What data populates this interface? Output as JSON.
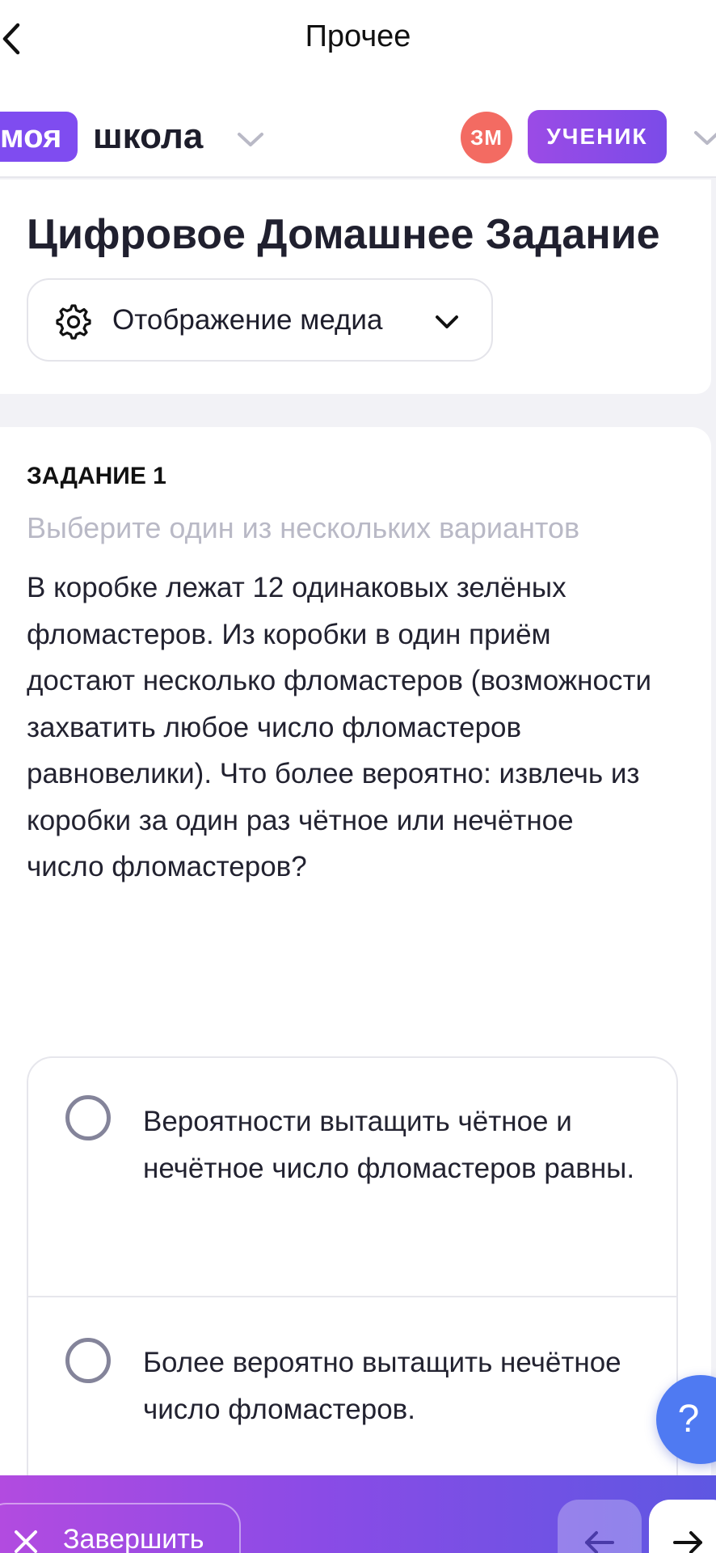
{
  "nav": {
    "title": "Прочее"
  },
  "brand": {
    "part1": "моя",
    "part2": "школа"
  },
  "user": {
    "initials": "ЗМ",
    "role": "УЧЕНИК"
  },
  "header": {
    "title": "Цифровое Домашнее Задание",
    "media_button_label": "Отображение медиа"
  },
  "task": {
    "number_label": "ЗАДАНИЕ 1",
    "hint": "Выберите один из нескольких вариантов",
    "text": "В коробке лежат 12 одинаковых зелёных фломастеров. Из коробки в один приём достают несколько фломастеров (возможности захватить любое число фломастеров равновелики). Что более вероятно: извлечь из коробки за один раз чётное или нечётное число фломастеров?",
    "options": [
      {
        "label": "Вероятности вытащить чётное и нечётное число фломастеров равны."
      },
      {
        "label": "Более вероятно вытащить нечётное число фломастеров."
      }
    ]
  },
  "help": {
    "label": "?"
  },
  "footer": {
    "finish_label": "Завершить"
  },
  "colors": {
    "brand_purple": "#7f4cf0",
    "avatar_red": "#f36b62",
    "help_blue": "#4f7af2"
  }
}
